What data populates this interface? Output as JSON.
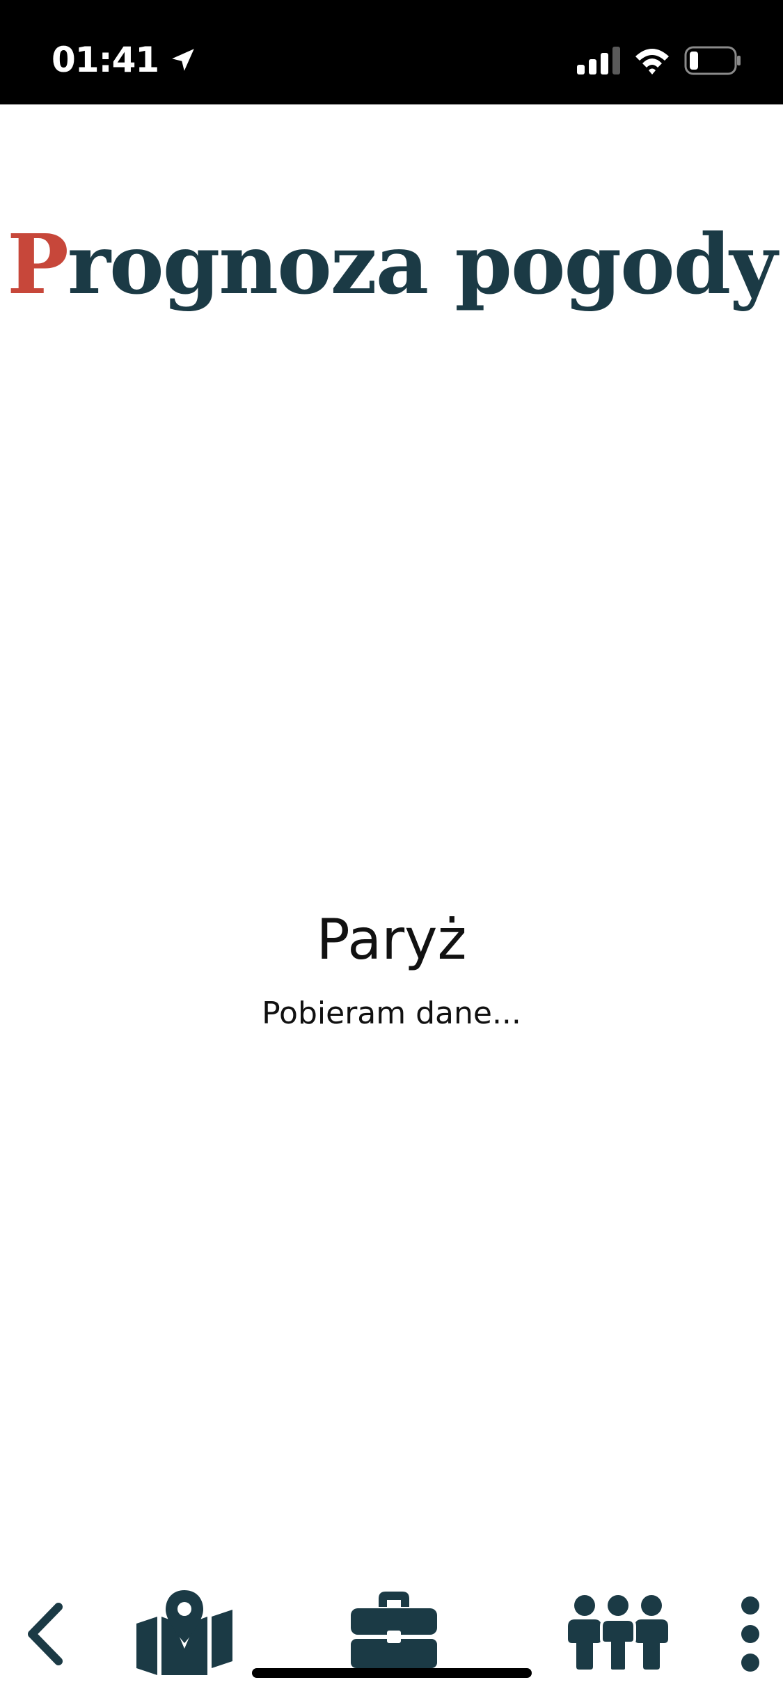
{
  "status_bar": {
    "time": "01:41",
    "icons": [
      "location-arrow-icon",
      "signal-icon",
      "wifi-icon",
      "battery-icon"
    ]
  },
  "header": {
    "title_first_letter": "P",
    "title_rest": "rognoza pogody",
    "accent_color": "#c7473a",
    "brand_color": "#1b3a45"
  },
  "main": {
    "city": "Paryż",
    "status": "Pobieram dane..."
  },
  "bottom_nav": {
    "items": [
      "back-icon",
      "map-icon",
      "briefcase-icon",
      "people-icon",
      "more-vertical-icon"
    ]
  }
}
